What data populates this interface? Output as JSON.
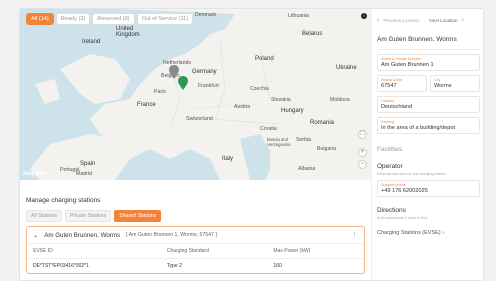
{
  "map": {
    "filters": [
      {
        "label": "All (14)",
        "active": true
      },
      {
        "label": "Ready (3)",
        "active": false
      },
      {
        "label": "Reserved (0)",
        "active": false
      },
      {
        "label": "Out of Service (11)",
        "active": false
      }
    ],
    "labels": {
      "denmark": "Denmark",
      "lithuania": "Lithuania",
      "belarus": "Belarus",
      "ireland": "Ireland",
      "united_kingdom": "United\nKingdom",
      "netherlands": "Netherlands",
      "germany": "Germany",
      "poland": "Poland",
      "ukraine": "Ukraine",
      "belgium": "Belgium",
      "paris": "Paris",
      "frankfurt": "Frankfurt",
      "czechia": "Czechia",
      "slovakia": "Slovakia",
      "moldova": "Moldova",
      "france": "France",
      "austria": "Austria",
      "hungary": "Hungary",
      "switzerland": "Switzerland",
      "romania": "Romania",
      "croatia": "Croatia",
      "serbia": "Serbia",
      "bosnia": "Bosnia and\nHerzegovina",
      "bulgaria": "Bulgaria",
      "spain": "Spain",
      "portugal": "Portugal",
      "italy": "Italy",
      "madrid": "Madrid",
      "albania": "Albania"
    },
    "logo": "mapbox",
    "zoom_in": "+",
    "zoom_out": "−"
  },
  "details": {
    "prev": "Previous Location",
    "next": "Next Location",
    "title": "Am Guten Brunnen, Worms",
    "street_label": "Street & House Number",
    "street_value": "Am Guten Brunnen 1",
    "postal_label": "Postal Code",
    "postal_value": "67547",
    "city_label": "City",
    "city_value": "Worms",
    "country_label": "Country",
    "country_value": "Deutschland",
    "parking_label": "Parking",
    "parking_value": "In the area of a building/depot",
    "facilities": "Facilities",
    "operator": "Operator",
    "operator_note": "External operator for the charging station",
    "support_label": "Support phone",
    "support_value": "+49 176 62002025",
    "directions": "Directions",
    "directions_note": "Add instructions if hard to find",
    "cs_link": "Charging Stations (EVSE)"
  },
  "manage": {
    "title": "Manage charging stations",
    "tabs": [
      {
        "label": "All Stations",
        "active": false
      },
      {
        "label": "Private Stations",
        "active": false
      },
      {
        "label": "Shared Stations",
        "active": true
      }
    ],
    "station_name": "Am Guten Brunnen, Worms",
    "station_addr": "[ Am Guten Brunnen 1, Worms, 67547 ]",
    "columns": [
      "EVSE ID",
      "Charging Standard",
      "Max Power (kW)"
    ],
    "rows": [
      [
        "DE*TST*EP03416*002*1",
        "Type 2",
        "160"
      ]
    ]
  }
}
